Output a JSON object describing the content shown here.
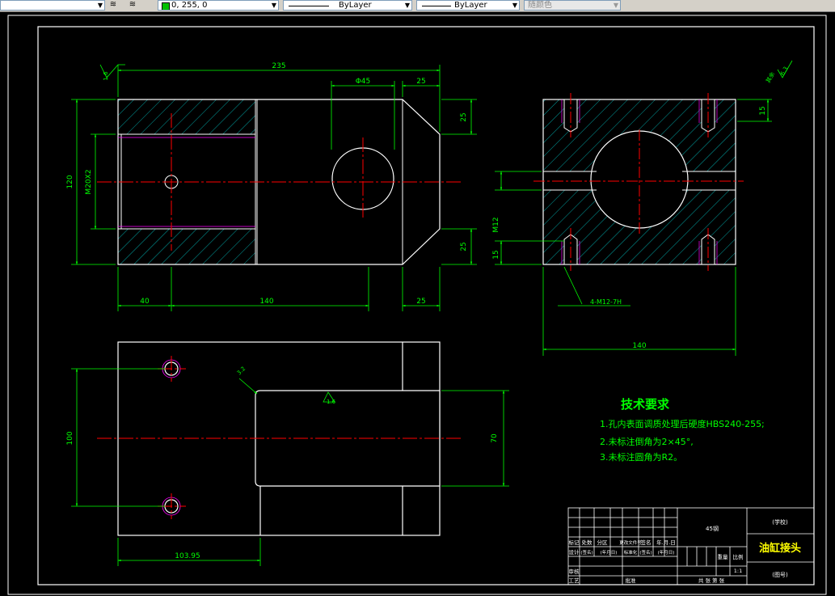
{
  "toolbar": {
    "color_value": "0, 255, 0",
    "linetype": "ByLayer",
    "lineweight": "ByLayer",
    "plotstyle": "随颜色"
  },
  "colors": {
    "background": "#000000",
    "border": "#ffffff",
    "dimension": "#00ff00",
    "hatch": "#00ffff",
    "centerline": "#ff0000",
    "thread": "#ff00ff",
    "notes": "#00ff00"
  },
  "dims": {
    "top_width": "235",
    "bore": "Φ45",
    "chamfer_top": "25",
    "right_top": "25",
    "right_bottom": "25",
    "left_height": "120",
    "thread_left": "M20X2",
    "bottom_40": "40",
    "bottom_140": "140",
    "bottom_25": "25",
    "roughness_left": "1.6",
    "side_top": "15",
    "side_m12": "M12",
    "side_15": "15",
    "side_holes": "4-M12-7H",
    "side_width": "140",
    "roughness_corner": "6.3",
    "roughness_corner_label": "其余",
    "plan_height": "100",
    "plan_70": "70",
    "plan_roughness": "1.6",
    "plan_roughness_2": "3.2",
    "plan_width": "103.95"
  },
  "notes": {
    "title": "技术要求",
    "line1": "1.孔内表面调质处理后硬度HBS240-255;",
    "line2": "2.未标注倒角为2×45°,",
    "line3": "3.未标注圆角为R2。"
  },
  "title_block": {
    "material": "45钢",
    "school": "(学校)",
    "part_name": "油缸接头",
    "drawing_no": "(图号)",
    "scale_label": "比例",
    "scale": "1:1",
    "weight_label": "重量",
    "row1": [
      "标记",
      "处数",
      "分区",
      "更改文件号",
      "签名",
      "年.月.日"
    ],
    "row2": [
      "设计",
      "(签名)",
      "(年月日)",
      "标准化",
      "(签名)",
      "(年月日)"
    ],
    "row3": [
      "审核"
    ],
    "row4": [
      "工艺",
      "",
      "",
      "批准"
    ],
    "sheet": "共  张  第  张"
  }
}
